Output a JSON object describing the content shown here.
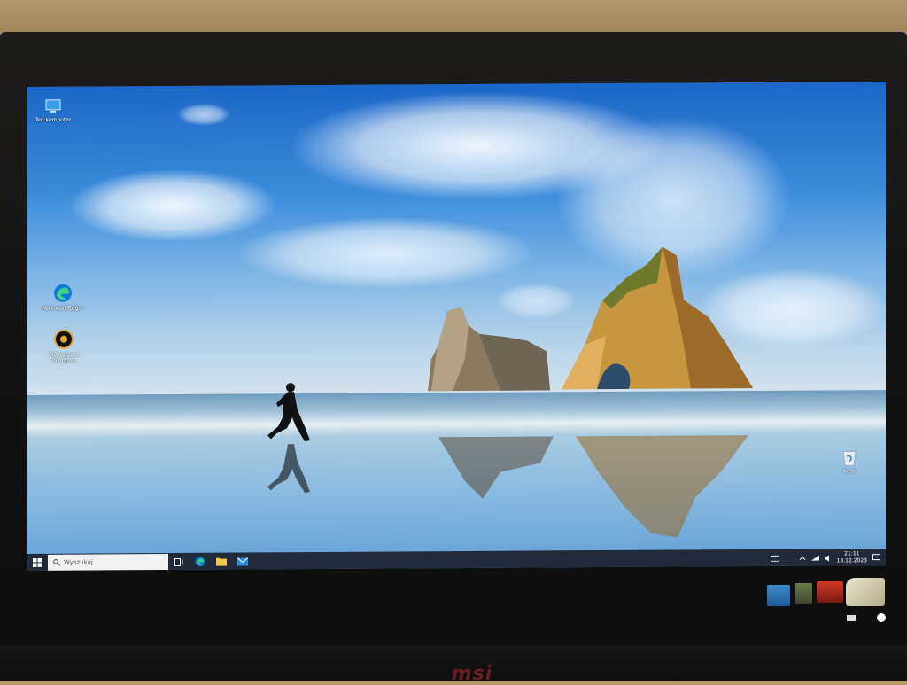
{
  "desktop": {
    "icons": [
      {
        "id": "this-pc",
        "label": "Ten komputer"
      },
      {
        "id": "edge",
        "label": "Microsoft Edge"
      },
      {
        "id": "media-player",
        "label": "Odtwarzacz Windows"
      },
      {
        "id": "recycle-bin",
        "label": "Kosz"
      }
    ]
  },
  "taskbar": {
    "search_placeholder": "Wyszukaj",
    "pinned": [
      "task-view",
      "edge",
      "file-explorer",
      "mail"
    ],
    "tray": {
      "time": "21:11",
      "date": "13.12.2023"
    }
  },
  "monitor": {
    "brand": "msi",
    "stickers": [
      "intel",
      "ati",
      "intel-pentium"
    ]
  },
  "colors": {
    "taskbar": "#202a38",
    "sky_top": "#1c66c8",
    "brand_red": "#6a1e22"
  }
}
